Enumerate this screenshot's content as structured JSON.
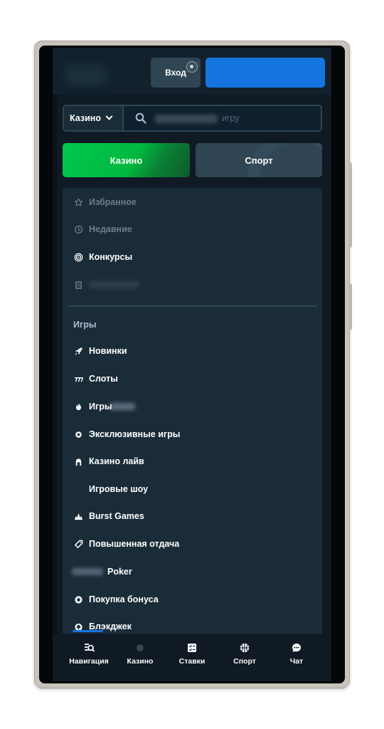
{
  "header": {
    "login_label": "Вход",
    "register_label": ""
  },
  "search": {
    "category_selected": "Казино",
    "placeholder_visible": "игру"
  },
  "toggle": {
    "casino_label": "Казино",
    "sport_label": "Спорт",
    "active": "Казино"
  },
  "menu": {
    "top_items": [
      {
        "label": "Избранное",
        "icon": "star-icon",
        "muted": true
      },
      {
        "label": "Недавние",
        "icon": "history-icon",
        "muted": true
      },
      {
        "label": "Конкурсы",
        "icon": "target-icon",
        "muted": false
      },
      {
        "label": "",
        "icon": "receipt-icon",
        "muted": true
      }
    ],
    "section_title": "Игры",
    "game_items": [
      {
        "label": "Новинки",
        "icon": "rocket-icon"
      },
      {
        "label": "Слоты",
        "icon": "slots-icon"
      },
      {
        "label": "Игры",
        "icon": "flame-icon"
      },
      {
        "label": "Эксклюзивные игры",
        "icon": "exclusive-icon"
      },
      {
        "label": "Казино лайв",
        "icon": "live-dealer-icon"
      },
      {
        "label": "Игровые шоу",
        "icon": "game-show-icon"
      },
      {
        "label": "Burst Games",
        "icon": "burst-icon"
      },
      {
        "label": "Повышенная отдача",
        "icon": "rtp-icon"
      },
      {
        "label": "Poker",
        "icon": "poker-icon"
      },
      {
        "label": "Покупка бонуса",
        "icon": "bonus-buy-icon"
      },
      {
        "label": "Блэкджек",
        "icon": "blackjack-icon"
      }
    ]
  },
  "bottom_nav": [
    {
      "label": "Навигация",
      "icon": "browse-icon"
    },
    {
      "label": "Казино",
      "icon": "casino-icon"
    },
    {
      "label": "Ставки",
      "icon": "bets-icon"
    },
    {
      "label": "Спорт",
      "icon": "sport-ball-icon"
    },
    {
      "label": "Чат",
      "icon": "chat-icon"
    }
  ],
  "colors": {
    "background": "#0f1a24",
    "panel": "#1a2c38",
    "accent_blue": "#1475e1",
    "accent_green": "#00c74d",
    "muted_text": "#6b7d8c"
  }
}
